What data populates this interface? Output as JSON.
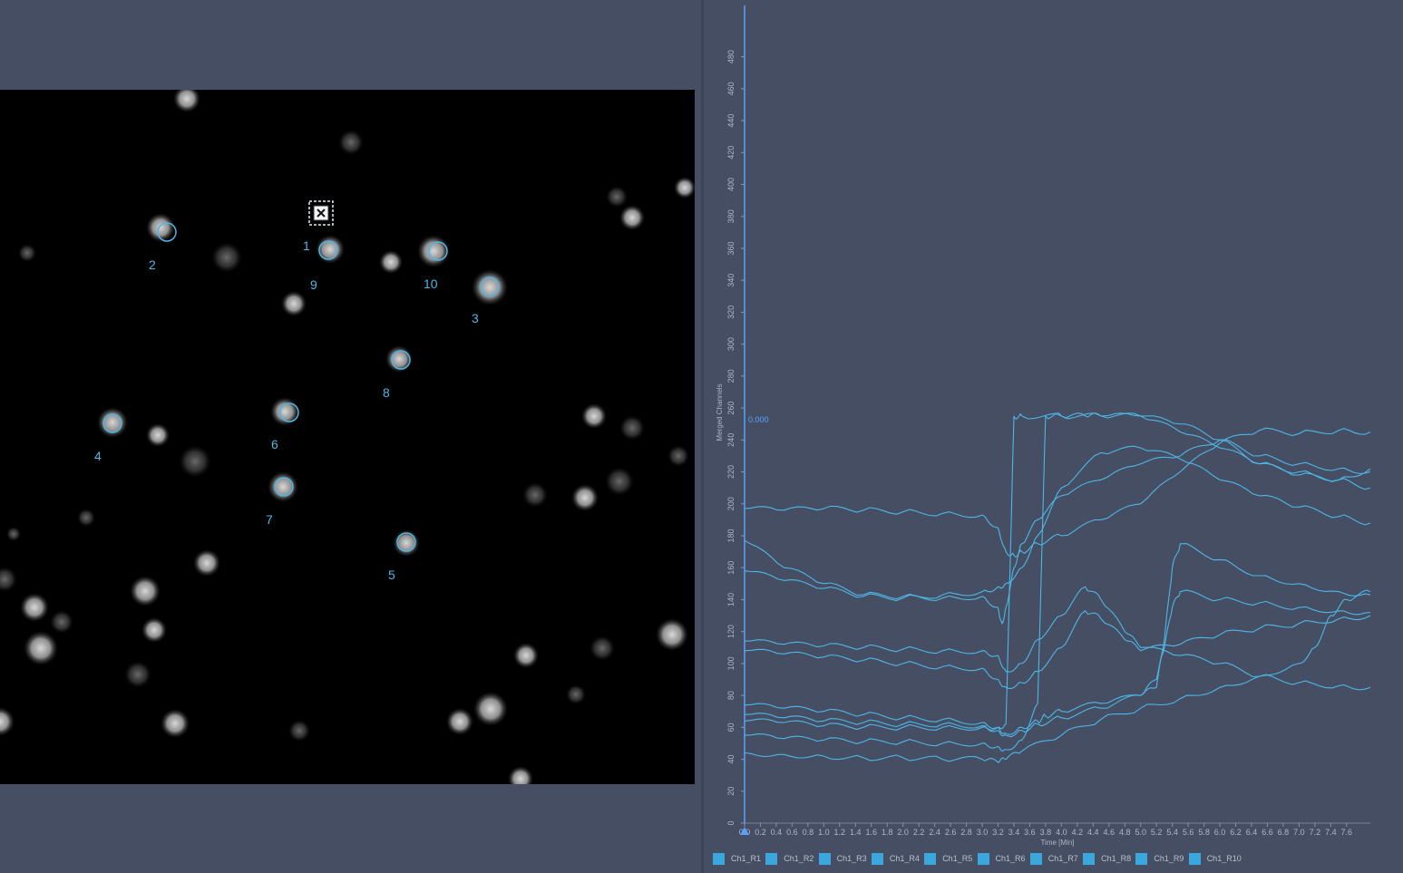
{
  "image_view": {
    "rois": [
      {
        "label": "1",
        "marker": "crosshair-box"
      },
      {
        "label": "2"
      },
      {
        "label": "3"
      },
      {
        "label": "4"
      },
      {
        "label": "5"
      },
      {
        "label": "6"
      },
      {
        "label": "7"
      },
      {
        "label": "8"
      },
      {
        "label": "9"
      },
      {
        "label": "10"
      }
    ]
  },
  "chart": {
    "cursor_value": "0.000",
    "legend": [
      "Ch1_R1",
      "Ch1_R2",
      "Ch1_R3",
      "Ch1_R4",
      "Ch1_R5",
      "Ch1_R6",
      "Ch1_R7",
      "Ch1_R8",
      "Ch1_R9",
      "Ch1_R10"
    ],
    "colors": {
      "series": "#4fb6e6",
      "cursor": "#5aa0ff",
      "legend_swatch": "#3aa8dc",
      "background": "#454e63"
    }
  },
  "chart_data": {
    "type": "line",
    "xlabel": "Time [Min]",
    "ylabel": "Merged Channels",
    "xlim": [
      0,
      7.9
    ],
    "ylim": [
      0,
      490
    ],
    "x_ticks": [
      "0.0",
      "0.2",
      "0.4",
      "0.6",
      "0.8",
      "1.0",
      "1.2",
      "1.4",
      "1.6",
      "1.8",
      "2.0",
      "2.2",
      "2.4",
      "2.6",
      "2.8",
      "3.0",
      "3.2",
      "3.4",
      "3.6",
      "3.8",
      "4.0",
      "4.2",
      "4.4",
      "4.6",
      "4.8",
      "5.0",
      "5.2",
      "5.4",
      "5.6",
      "5.8",
      "6.0",
      "6.2",
      "6.4",
      "6.6",
      "6.8",
      "7.0",
      "7.2",
      "7.4",
      "7.6"
    ],
    "y_ticks": [
      0,
      20,
      40,
      60,
      80,
      100,
      120,
      140,
      160,
      180,
      200,
      220,
      240,
      260,
      280,
      300,
      320,
      340,
      360,
      380,
      400,
      420,
      440,
      460,
      480
    ],
    "series": [
      {
        "name": "Ch1_R1",
        "x": [
          0,
          0.5,
          1,
          1.5,
          2,
          2.5,
          3,
          3.2,
          3.3,
          3.4,
          3.5,
          3.7,
          4.0,
          4.5,
          5.0,
          5.5,
          6.0,
          6.5,
          7.0,
          7.5,
          7.9
        ],
        "y": [
          197,
          196,
          197,
          196,
          195,
          194,
          193,
          185,
          170,
          168,
          170,
          175,
          180,
          190,
          200,
          220,
          238,
          246,
          244,
          246,
          245
        ]
      },
      {
        "name": "Ch1_R2",
        "x": [
          0,
          0.5,
          1,
          1.5,
          2,
          2.5,
          3,
          3.2,
          3.25,
          3.3,
          3.4,
          3.5,
          3.7,
          4.0,
          4.5,
          5.0,
          5.5,
          6.0,
          6.5,
          7.0,
          7.5,
          7.9
        ],
        "y": [
          177,
          160,
          150,
          143,
          142,
          141,
          142,
          135,
          125,
          135,
          160,
          175,
          190,
          205,
          215,
          225,
          230,
          240,
          225,
          220,
          215,
          222
        ]
      },
      {
        "name": "Ch1_R3",
        "x": [
          0,
          0.5,
          1,
          1.5,
          2,
          2.5,
          3,
          3.2,
          3.3,
          3.5,
          3.7,
          4.0,
          4.5,
          5.0,
          5.5,
          6.0,
          6.5,
          7.0,
          7.5,
          7.9
        ],
        "y": [
          158,
          152,
          147,
          142,
          141,
          143,
          145,
          148,
          150,
          160,
          180,
          210,
          232,
          235,
          228,
          215,
          205,
          198,
          192,
          188
        ]
      },
      {
        "name": "Ch1_R4",
        "x": [
          0,
          0.5,
          1,
          1.5,
          2,
          2.5,
          3,
          3.2,
          3.3,
          3.5,
          3.7,
          4.0,
          4.3,
          4.5,
          4.8,
          5.0,
          5.5,
          6.0,
          6.5,
          7.0,
          7.5,
          7.9
        ],
        "y": [
          114,
          112,
          111,
          110,
          109,
          108,
          108,
          105,
          95,
          100,
          115,
          130,
          148,
          140,
          120,
          110,
          105,
          100,
          92,
          88,
          86,
          85
        ]
      },
      {
        "name": "Ch1_R5",
        "x": [
          0,
          0.5,
          1,
          1.5,
          2,
          2.5,
          3,
          3.2,
          3.3,
          3.5,
          3.7,
          4.0,
          4.3,
          4.5,
          4.8,
          5.0,
          5.5,
          6.0,
          6.5,
          7.0,
          7.5,
          7.9
        ],
        "y": [
          108,
          106,
          104,
          102,
          100,
          98,
          97,
          90,
          85,
          88,
          95,
          110,
          133,
          128,
          115,
          108,
          112,
          118,
          122,
          125,
          128,
          130
        ]
      },
      {
        "name": "Ch1_R6",
        "x": [
          0,
          0.5,
          1,
          1.5,
          2,
          2.5,
          3,
          3.2,
          3.3,
          3.5,
          3.7,
          3.8,
          4.0,
          4.5,
          5.0,
          5.2,
          5.3,
          5.4,
          5.5,
          6.0,
          6.5,
          7.0,
          7.5,
          7.9
        ],
        "y": [
          74,
          72,
          70,
          68,
          66,
          65,
          63,
          60,
          56,
          60,
          64,
          67,
          70,
          75,
          80,
          85,
          115,
          160,
          175,
          165,
          155,
          150,
          145,
          143
        ]
      },
      {
        "name": "Ch1_R7",
        "x": [
          0,
          0.5,
          1,
          1.5,
          2,
          2.5,
          3,
          3.2,
          3.3,
          3.5,
          3.7,
          4.0,
          4.5,
          5.0,
          5.2,
          5.3,
          5.4,
          5.5,
          6.0,
          6.5,
          7.0,
          7.5,
          7.9
        ],
        "y": [
          68,
          66,
          64,
          63,
          62,
          62,
          61,
          58,
          55,
          58,
          62,
          66,
          72,
          80,
          90,
          110,
          135,
          145,
          140,
          138,
          135,
          133,
          132
        ]
      },
      {
        "name": "Ch1_R8",
        "x": [
          0,
          0.5,
          1,
          1.5,
          2,
          2.5,
          3,
          3.2,
          3.3,
          3.4,
          3.5,
          4.0,
          4.5,
          5.0,
          5.5,
          6.0,
          6.5,
          7.0,
          7.5,
          7.9
        ],
        "y": [
          64,
          63,
          61,
          60,
          60,
          60,
          60,
          60,
          62,
          255,
          255,
          255,
          255,
          255,
          245,
          235,
          225,
          218,
          215,
          210
        ]
      },
      {
        "name": "Ch1_R9",
        "x": [
          0,
          0.5,
          1,
          1.5,
          2,
          2.5,
          3,
          3.2,
          3.3,
          3.5,
          3.7,
          3.8,
          4.0,
          4.3,
          4.5,
          5.0,
          5.5,
          6.0,
          6.5,
          7.0,
          7.5,
          7.9
        ],
        "y": [
          55,
          53,
          52,
          51,
          51,
          50,
          50,
          48,
          46,
          52,
          75,
          255,
          255,
          255,
          255,
          255,
          250,
          240,
          230,
          225,
          222,
          220
        ]
      },
      {
        "name": "Ch1_R10",
        "x": [
          0,
          0.5,
          1,
          1.5,
          2,
          2.5,
          3,
          3.2,
          3.3,
          3.5,
          4.0,
          4.5,
          5.0,
          5.5,
          6.0,
          6.5,
          7.0,
          7.2,
          7.4,
          7.6,
          7.9
        ],
        "y": [
          44,
          43,
          42,
          41,
          41,
          40,
          40,
          38,
          40,
          45,
          55,
          65,
          72,
          78,
          85,
          92,
          100,
          110,
          130,
          140,
          145
        ]
      }
    ]
  }
}
